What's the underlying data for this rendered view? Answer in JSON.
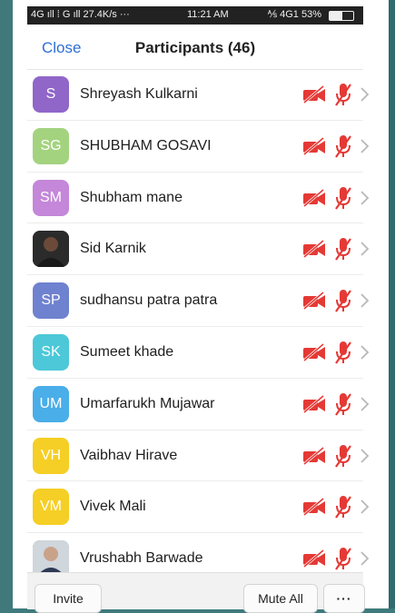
{
  "statusbar": {
    "left_text": "4G ıll ⁞ G ıll 27.4K/s ···",
    "time": "11:21 AM",
    "right_text": "⅍ 4G1 53%",
    "battery_level": 0.53
  },
  "header": {
    "close_label": "Close",
    "title": "Participants (46)"
  },
  "participants": [
    {
      "initials": "S",
      "name": "Shreyash  Kulkarni",
      "color": "#9066c9",
      "photo": false,
      "video_muted": true,
      "audio_muted": true
    },
    {
      "initials": "SG",
      "name": "SHUBHAM GOSAVI",
      "color": "#a4d37f",
      "photo": false,
      "video_muted": true,
      "audio_muted": true
    },
    {
      "initials": "SM",
      "name": "Shubham mane",
      "color": "#c487d9",
      "photo": false,
      "video_muted": true,
      "audio_muted": true
    },
    {
      "initials": "",
      "name": "Sid Karnik",
      "color": "#3a3a3a",
      "photo": true,
      "video_muted": true,
      "audio_muted": true
    },
    {
      "initials": "SP",
      "name": "sudhansu patra patra",
      "color": "#6f82cf",
      "photo": false,
      "video_muted": true,
      "audio_muted": true
    },
    {
      "initials": "SK",
      "name": "Sumeet khade",
      "color": "#4cc8d8",
      "photo": false,
      "video_muted": true,
      "audio_muted": true
    },
    {
      "initials": "UM",
      "name": "Umarfarukh Mujawar",
      "color": "#4aaee8",
      "photo": false,
      "video_muted": true,
      "audio_muted": true
    },
    {
      "initials": "VH",
      "name": "Vaibhav Hirave",
      "color": "#f5cf25",
      "photo": false,
      "video_muted": true,
      "audio_muted": true
    },
    {
      "initials": "VM",
      "name": "Vivek Mali",
      "color": "#f5cf25",
      "photo": false,
      "video_muted": true,
      "audio_muted": true
    },
    {
      "initials": "",
      "name": "Vrushabh Barwade",
      "color": "#5a6a7a",
      "photo": true,
      "video_muted": true,
      "audio_muted": true
    }
  ],
  "footer": {
    "invite_label": "Invite",
    "mute_all_label": "Mute All",
    "more_label": "···"
  },
  "colors": {
    "accent": "#2d6fd6",
    "muted_red": "#e53935",
    "chevron": "#b8b8b8"
  }
}
